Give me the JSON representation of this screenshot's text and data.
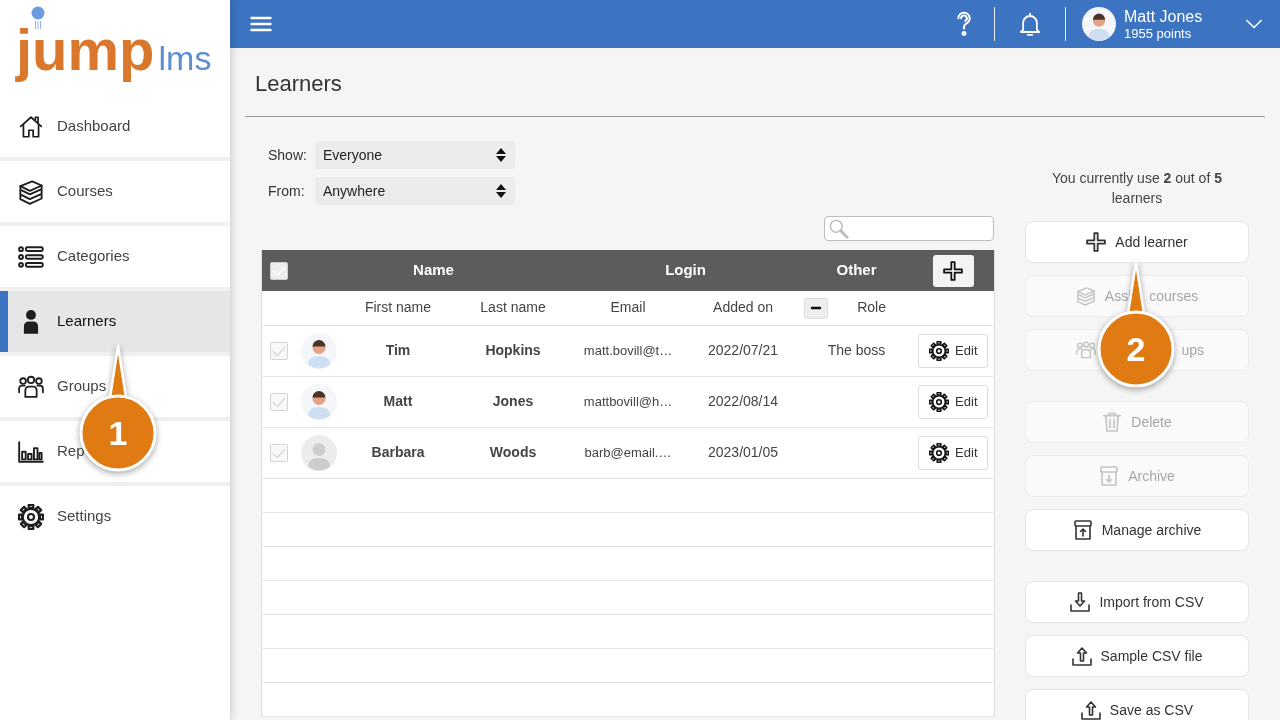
{
  "sidebar": {
    "logo": {
      "wordmark": "jump",
      "suffix": "lms"
    },
    "items": [
      {
        "label": "Dashboard",
        "selected": false
      },
      {
        "label": "Courses",
        "selected": false
      },
      {
        "label": "Categories",
        "selected": false
      },
      {
        "label": "Learners",
        "selected": true
      },
      {
        "label": "Groups",
        "selected": false
      },
      {
        "label": "Rep",
        "selected": false
      },
      {
        "label": "Settings",
        "selected": false
      }
    ]
  },
  "topbar": {
    "user": {
      "name": "Matt Jones",
      "points": "1955 points"
    }
  },
  "page": {
    "title": "Learners"
  },
  "filters": [
    {
      "label": "Show:",
      "value": "Everyone"
    },
    {
      "label": "From:",
      "value": "Anywhere"
    }
  ],
  "table": {
    "select_all": {
      "checked": false
    },
    "column_groups": [
      "Name",
      "Login",
      "Other"
    ],
    "columns": [
      "First name",
      "Last name",
      "Email",
      "Added on",
      "Role"
    ],
    "rows": [
      {
        "kind": "custom_avatar",
        "checked": false,
        "first_name": "Tim",
        "last_name": "Hopkins",
        "email": "matt.bovill@t…",
        "added_on": "2022/07/21",
        "role": "The boss",
        "action": "Edit"
      },
      {
        "kind": "custom_avatar",
        "checked": false,
        "first_name": "Matt",
        "last_name": "Jones",
        "email": "mattbovill@h…",
        "added_on": "2022/08/14",
        "action": "Edit"
      },
      {
        "kind": "default_avatar",
        "checked": false,
        "first_name": "Barbara",
        "last_name": "Woods",
        "email": "barb@email.…",
        "added_on": "2023/01/05",
        "action": "Edit"
      }
    ]
  },
  "usage": "You currently use **2** out of **5** learners",
  "action_groups": [
    {
      "buttons": [
        {
          "label": "Add learner",
          "disabled": false,
          "kind": "plain"
        },
        {
          "label": "Assi courses",
          "disabled": true,
          "kind": "plain"
        },
        {
          "label": "ups",
          "disabled": true,
          "kind": "covered"
        }
      ]
    },
    {
      "buttons": [
        {
          "label": "Delete",
          "disabled": true,
          "kind": "plain"
        },
        {
          "label": "Archive",
          "disabled": true,
          "kind": "plain"
        },
        {
          "label": "Manage archive",
          "disabled": false,
          "kind": "plain"
        }
      ]
    },
    {
      "buttons": [
        {
          "label": "Import from CSV",
          "disabled": false,
          "kind": "plain"
        },
        {
          "label": "Sample CSV file",
          "disabled": false,
          "kind": "plain"
        },
        {
          "label": "Save as CSV",
          "disabled": false,
          "kind": "plain"
        }
      ]
    }
  ],
  "callouts": [
    {
      "number": "1"
    },
    {
      "number": "2"
    }
  ]
}
